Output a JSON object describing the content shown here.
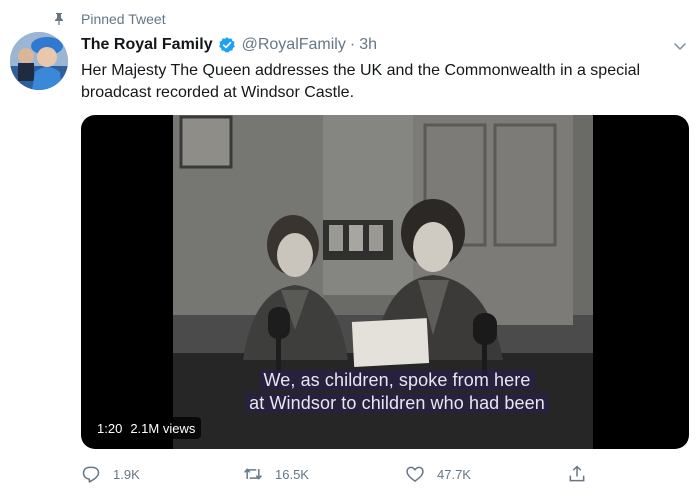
{
  "pinned": {
    "label": "Pinned Tweet",
    "icon": "pin-icon"
  },
  "author": {
    "display_name": "The Royal Family",
    "handle": "@RoyalFamily",
    "separator": "·",
    "time": "3h",
    "verified_icon": "verified-badge-icon",
    "avatar": "avatar"
  },
  "tweet": {
    "text": "Her Majesty The Queen addresses the UK and the Commonwealth in a special broadcast recorded at Windsor Castle."
  },
  "media": {
    "subtitle_line1": "We, as children, spoke from here",
    "subtitle_line2": "at Windsor to children who had been",
    "duration": "1:20",
    "views": "2.1M views"
  },
  "actions": {
    "reply_count": "1.9K",
    "retweet_count": "16.5K",
    "like_count": "47.7K"
  },
  "colors": {
    "text": "#14171a",
    "secondary": "#657786",
    "verified": "#1da1f2"
  }
}
